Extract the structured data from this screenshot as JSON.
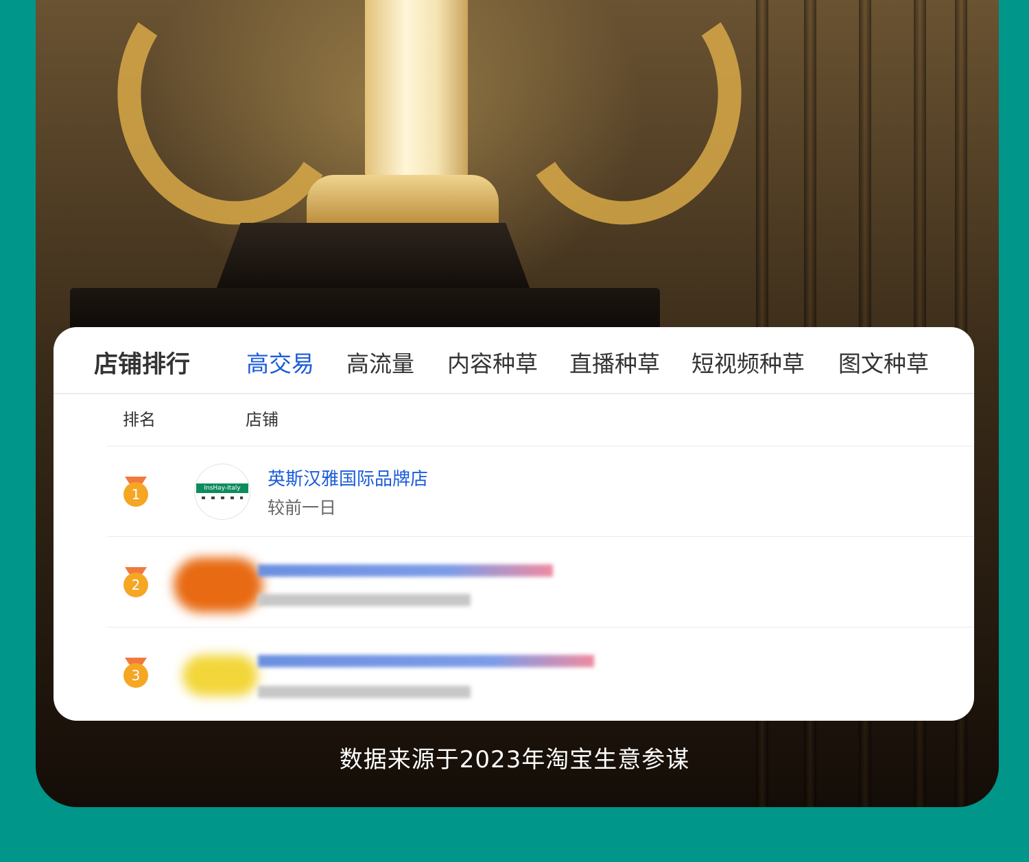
{
  "card": {
    "title": "店铺排行",
    "tabs": [
      {
        "label": "高交易",
        "active": true
      },
      {
        "label": "高流量",
        "active": false
      },
      {
        "label": "内容种草",
        "active": false
      },
      {
        "label": "直播种草",
        "active": false
      },
      {
        "label": "短视频种草",
        "active": false
      },
      {
        "label": "图文种草",
        "active": false
      }
    ],
    "columns": {
      "rank": "排名",
      "shop": "店铺"
    },
    "rows": [
      {
        "rank": "1",
        "shop_name": "英斯汉雅国际品牌店",
        "sub_text": "较前一日",
        "logo_text": "InsHay-Italy"
      },
      {
        "rank": "2"
      },
      {
        "rank": "3"
      }
    ]
  },
  "caption": "数据来源于2023年淘宝生意参谋",
  "colors": {
    "background": "#00968a",
    "accent": "#1a5bd9",
    "medal": "#f5a623"
  }
}
